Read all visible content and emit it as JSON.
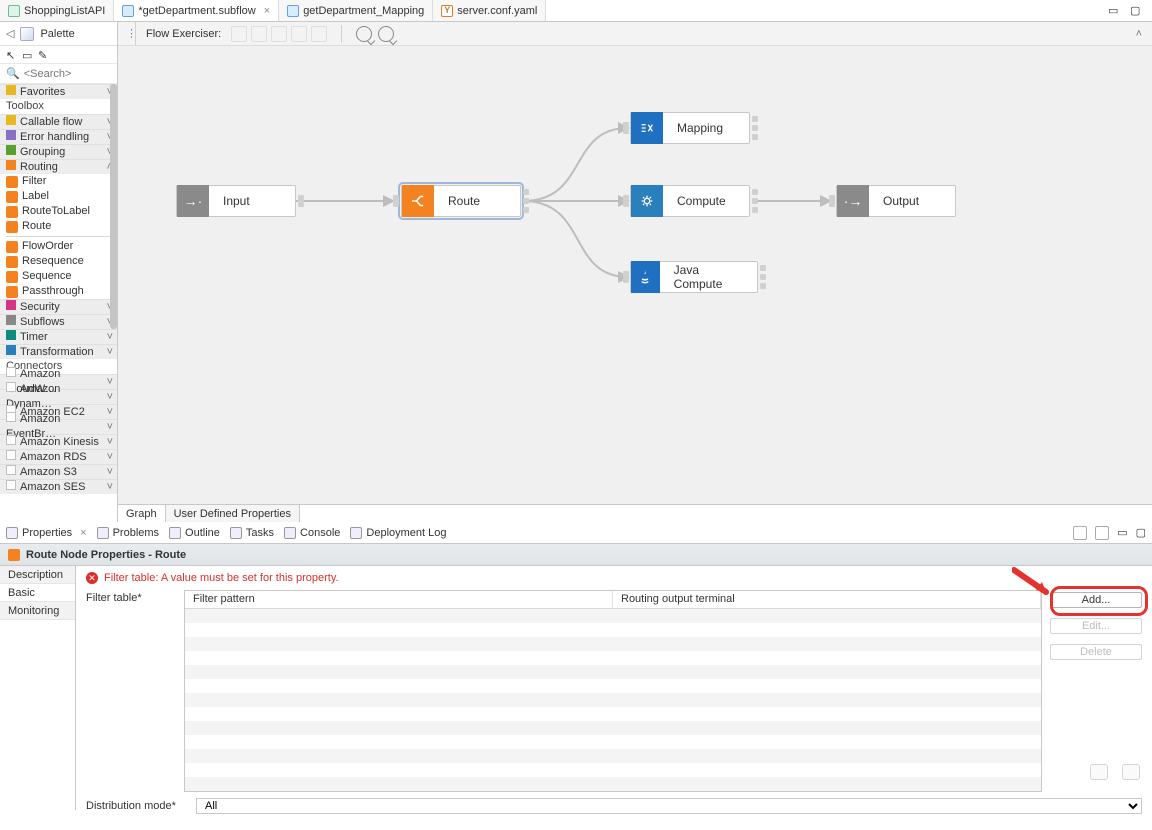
{
  "tabs": [
    {
      "label": "ShoppingListAPI",
      "kind": "api",
      "active": false,
      "closeable": false
    },
    {
      "label": "*getDepartment.subflow",
      "kind": "subflow",
      "active": true,
      "closeable": true
    },
    {
      "label": "getDepartment_Mapping",
      "kind": "subflow",
      "active": false,
      "closeable": false
    },
    {
      "label": "server.conf.yaml",
      "kind": "yaml",
      "active": false,
      "closeable": false
    }
  ],
  "palette": {
    "title": "Palette",
    "search_placeholder": "<Search>",
    "favorites": "Favorites",
    "toolbox": "Toolbox",
    "connectors": "Connectors",
    "cats": [
      {
        "label": "Callable flow",
        "open": false,
        "ic": "ye"
      },
      {
        "label": "Error handling",
        "open": false,
        "ic": "pu"
      },
      {
        "label": "Grouping",
        "open": false,
        "ic": "gr"
      },
      {
        "label": "Routing",
        "open": true,
        "ic": "or",
        "items": [
          {
            "label": "Filter",
            "ic": "or"
          },
          {
            "label": "Label",
            "ic": "or"
          },
          {
            "label": "RouteToLabel",
            "ic": "or"
          },
          {
            "label": "Route",
            "ic": "or"
          },
          {
            "label": "FlowOrder",
            "ic": "or",
            "sep_before": true
          },
          {
            "label": "Resequence",
            "ic": "or"
          },
          {
            "label": "Sequence",
            "ic": "or"
          },
          {
            "label": "Passthrough",
            "ic": "or"
          }
        ]
      },
      {
        "label": "Security",
        "open": false,
        "ic": "mg"
      },
      {
        "label": "Subflows",
        "open": false,
        "ic": "gy"
      },
      {
        "label": "Timer",
        "open": false,
        "ic": "tl"
      },
      {
        "label": "Transformation",
        "open": false,
        "ic": "bl"
      }
    ],
    "connectors_list": [
      "Amazon CloudW…",
      "Amazon Dynam…",
      "Amazon EC2",
      "Amazon EventBr…",
      "Amazon Kinesis",
      "Amazon RDS",
      "Amazon S3",
      "Amazon SES"
    ]
  },
  "editor": {
    "exerciser_label": "Flow Exerciser:",
    "bottom_tabs": [
      "Graph",
      "User Defined Properties"
    ],
    "nodes": {
      "input": "Input",
      "route": "Route",
      "mapping": "Mapping",
      "compute": "Compute",
      "javacompute": "Java Compute",
      "output": "Output"
    }
  },
  "views": {
    "items": [
      "Properties",
      "Problems",
      "Outline",
      "Tasks",
      "Console",
      "Deployment Log"
    ]
  },
  "props": {
    "header": "Route Node Properties - Route",
    "tabs": [
      "Description",
      "Basic",
      "Monitoring"
    ],
    "active_tab": "Basic",
    "error": "Filter table: A value must be set for this property.",
    "filter_label": "Filter table*",
    "col1": "Filter pattern",
    "col2": "Routing output terminal",
    "btn_add": "Add...",
    "btn_edit": "Edit...",
    "btn_delete": "Delete",
    "dist_label": "Distribution mode*",
    "dist_value": "All"
  }
}
